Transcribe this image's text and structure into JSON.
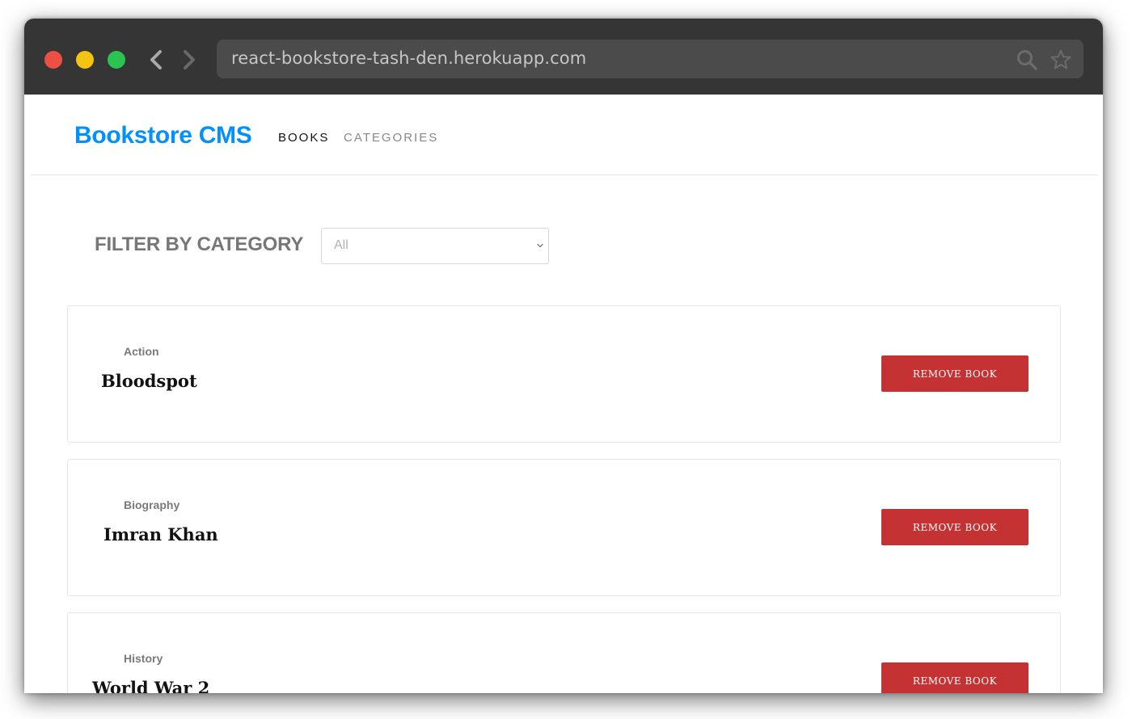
{
  "browser": {
    "url": "react-bookstore-tash-den.herokuapp.com",
    "icons": [
      "close-dot",
      "minimize-dot",
      "maximize-dot",
      "back-arrow-icon",
      "forward-arrow-icon",
      "search-icon",
      "star-icon"
    ]
  },
  "header": {
    "brand": "Bookstore CMS",
    "nav": [
      {
        "label": "BOOKS",
        "active": true
      },
      {
        "label": "CATEGORIES",
        "active": false
      }
    ]
  },
  "filter": {
    "label": "FILTER BY CATEGORY",
    "selected": "All"
  },
  "books": [
    {
      "category": "Action",
      "title": "Bloodspot",
      "button": "REMOVE BOOK"
    },
    {
      "category": "Biography",
      "title": "Imran Khan",
      "button": "REMOVE BOOK"
    },
    {
      "category": "History",
      "title": "World War 2",
      "button": "REMOVE BOOK"
    }
  ],
  "colors": {
    "brand": "#0290ff",
    "danger": "#c53234",
    "titlebar": "#353535"
  }
}
